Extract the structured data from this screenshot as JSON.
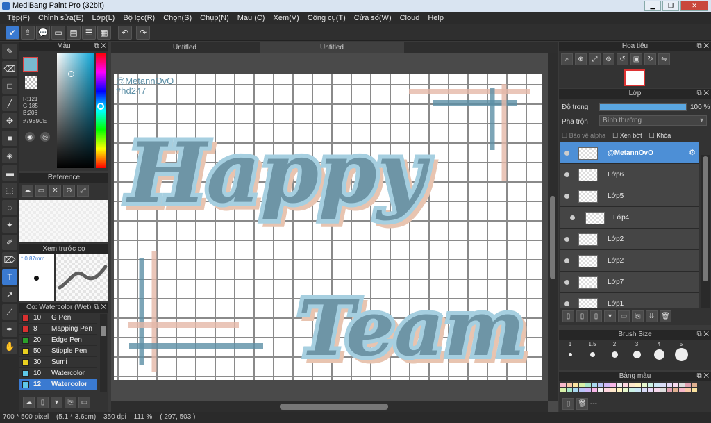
{
  "window": {
    "title": "MediBang Paint Pro (32bit)"
  },
  "menu": [
    "Tệp(F)",
    "Chỉnh sửa(E)",
    "Lớp(L)",
    "Bộ lọc(R)",
    "Chọn(S)",
    "Chụp(N)",
    "Màu (C)",
    "Xem(V)",
    "Công cụ(T)",
    "Cửa sổ(W)",
    "Cloud",
    "Help"
  ],
  "tabs": [
    "Untitled",
    "Untitled"
  ],
  "color_panel": {
    "title": "Màu",
    "r": "R:121",
    "g": "G:185",
    "b": "B:206",
    "hex": "#79B9CE",
    "fg_color": "#79B9CE"
  },
  "reference_panel": {
    "title": "Reference"
  },
  "brush_preview": {
    "title": "Xem trước cọ",
    "size": "0.87mm"
  },
  "brush_list": {
    "title": "Cọ: Watercolor (Wet)",
    "items": [
      {
        "num": "10",
        "name": "G Pen",
        "color": "#d93030"
      },
      {
        "num": "8",
        "name": "Mapping Pen",
        "color": "#d93030"
      },
      {
        "num": "20",
        "name": "Edge Pen",
        "color": "#2aa02a"
      },
      {
        "num": "50",
        "name": "Stipple Pen",
        "color": "#e8d020"
      },
      {
        "num": "30",
        "name": "Sumi",
        "color": "#e8d020"
      },
      {
        "num": "10",
        "name": "Watercolor",
        "color": "#5ec8e8"
      },
      {
        "num": "12",
        "name": "Watercolor",
        "color": "#5ec8e8"
      }
    ]
  },
  "navigator": {
    "title": "Hoa tiêu"
  },
  "layer_panel": {
    "title": "Lớp",
    "opacity_label": "Độ trong",
    "opacity_value": "100 %",
    "opacity": 1.0,
    "blend_label": "Pha trộn",
    "blend_value": "Bình thường",
    "protect_alpha": "Bảo vệ alpha",
    "clipping": "Xén bớt",
    "lock": "Khóa",
    "layers": [
      "@MetannOvO",
      "Lớp6",
      "Lớp5",
      "Lớp4",
      "Lớp2",
      "Lớp2",
      "Lớp7",
      "Lớp1"
    ]
  },
  "brush_size": {
    "title": "Brush Size",
    "sizes": [
      "1",
      "1.5",
      "2",
      "3",
      "4",
      "5"
    ]
  },
  "palette": {
    "title": "Bảng màu",
    "footer": "---"
  },
  "canvas": {
    "watermark1": "@MetannOvO",
    "watermark2": "#hd247",
    "word1": "Happy",
    "word2": "Team"
  },
  "status": {
    "size": "700 * 500 pixel",
    "cm": "(5.1 * 3.6cm)",
    "dpi": "350 dpi",
    "zoom": "111 %",
    "coords": "( 297, 503 )"
  }
}
